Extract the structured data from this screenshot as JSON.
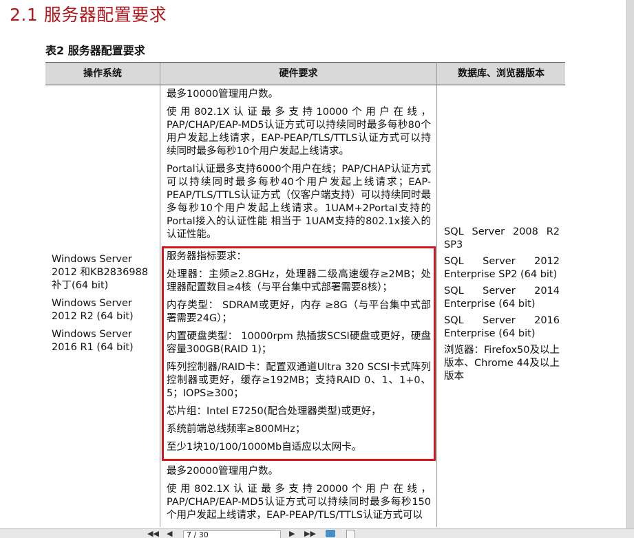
{
  "section_title": "2.1  服务器配置要求",
  "table_caption": "表2  服务器配置要求",
  "headers": {
    "os": "操作系统",
    "hardware": "硬件要求",
    "db": "数据库、浏览器版本"
  },
  "os_list": [
    "Windows Server 2012 和KB2836988补丁(64 bit)",
    "Windows Server 2012 R2 (64 bit)",
    "Windows Server 2016 R1 (64 bit)"
  ],
  "hardware": {
    "p1": "最多10000管理用户数。",
    "p2": "使用802.1X认证最多支持10000个用户在线，PAP/CHAP/EAP-MD5认证方式可以持续同时最多每秒80个用户发起上线请求，EAP-PEAP/TLS/TTLS认证方式可以持续同时最多每秒10个用户发起上线请求。",
    "p3": "Portal认证最多支持6000个用户在线；PAP/CHAP认证方式可以持续同时最多每秒40个用户发起上线请求；EAP-PEAP/TLS/TTLS认证方式（仅客户端支持）可以持续同时最多每秒10个用户发起上线请求。1UAM+2Portal支持的Portal接入的认证性能   相当于   1UAM支持的802.1x接入的认证性能。",
    "spec_title": "服务器指标要求：",
    "cpu": "处理器：主频≥2.8GHz，处理器二级高速缓存≥2MB；处理器配置数目≥4核（与平台集中式部署需要8核）；",
    "memory": "内存类型：  SDRAM或更好，内存 ≥8G（与平台集中式部署需要24G）；",
    "disk": "内置硬盘类型：  10000rpm 热插拔SCSI硬盘或更好，硬盘容量300GB(RAID 1)；",
    "raid": "阵列控制器/RAID卡：配置双通道Ultra 320 SCSI卡式阵列控制器或更好，缓存≥192MB；支持RAID 0、1、1+0、5；IOPS≥300；",
    "chipset": "芯片组：Intel E7250(配合处理器类型)或更好，",
    "fsb": "系统前端总线频率≥800MHz；",
    "nic": "至少1块10/100/1000Mb自适应以太网卡。",
    "p4": "最多20000管理用户数。",
    "p5": "使用802.1X认证最多支持20000个用户在线，PAP/CHAP/EAP-MD5认证方式可以持续同时最多每秒150个用户发起上线请求，EAP-PEAP/TLS/TTLS认证方式可以"
  },
  "db_list": [
    "SQL Server 2008 R2 SP3",
    "SQL Server 2012 Enterprise SP2 (64 bit)",
    "SQL Server 2014 Enterprise (64 bit)",
    "SQL Server 2016 Enterprise (64 bit)",
    "浏览器：Firefox50及以上版本、Chrome 44及以上版本"
  ],
  "toolbar": {
    "first": "◀◀",
    "prev": "◀",
    "page_value": "7 / 30",
    "next": "▶",
    "last": "▶▶"
  },
  "colors": {
    "heading": "#b0191d",
    "highlight_border": "#d2191f",
    "header_bg": "#d9d9d9"
  }
}
